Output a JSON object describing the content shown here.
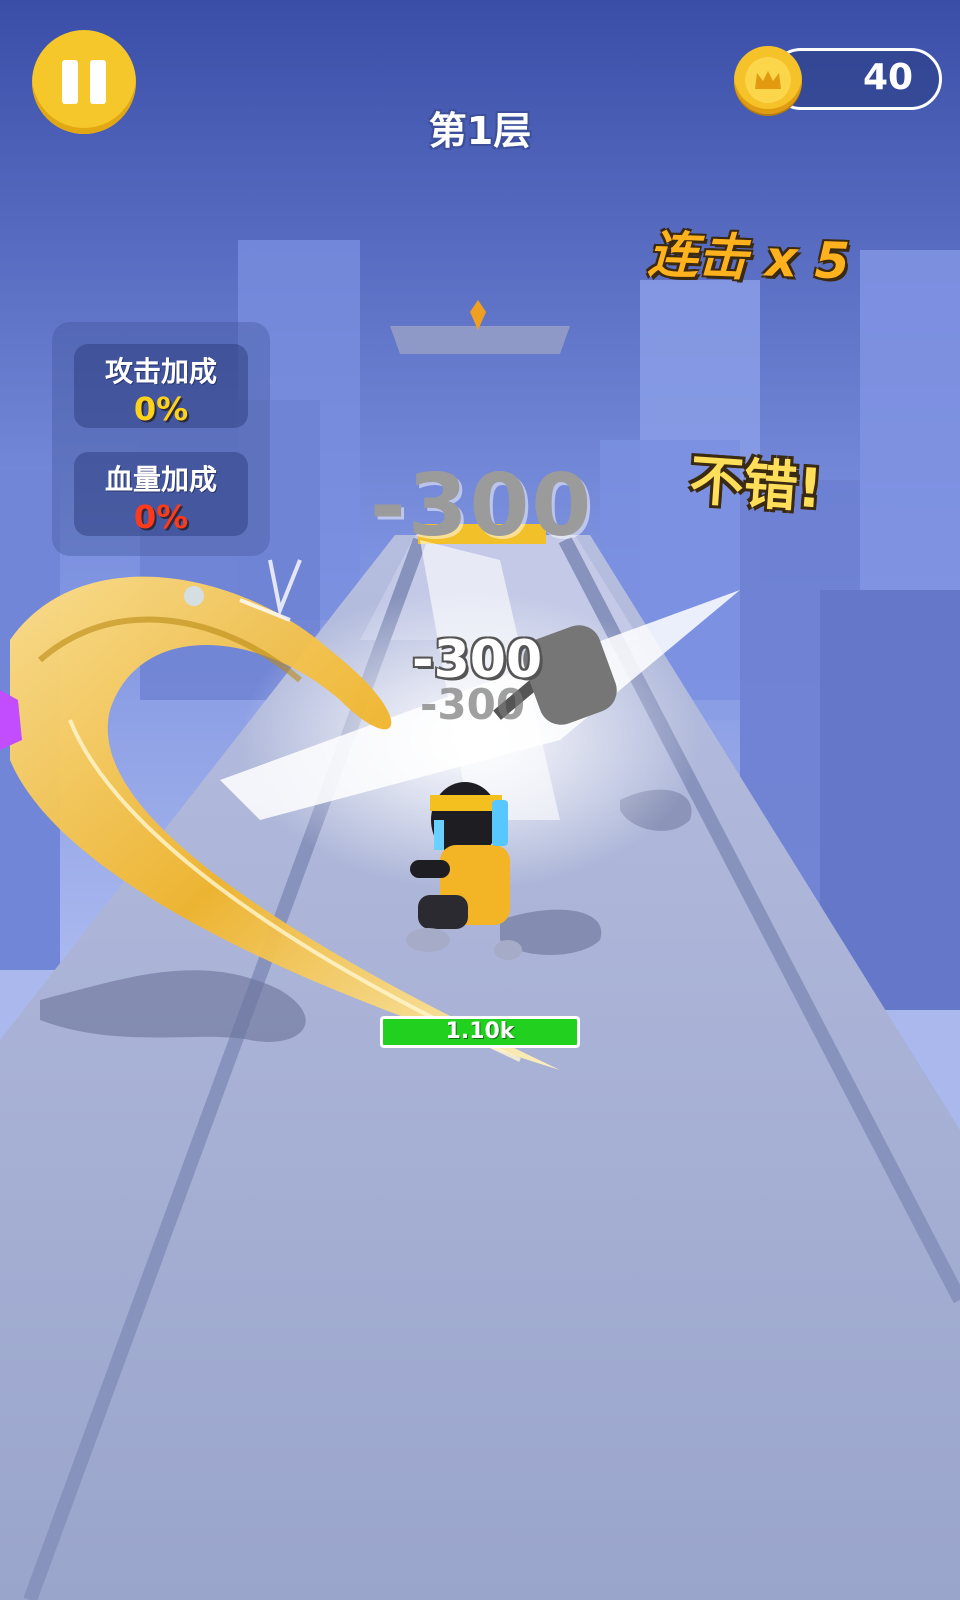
{
  "hud": {
    "level_title": "第1层",
    "coins": "40",
    "pause_icon": "pause-icon",
    "coin_icon": "crown-coin-icon"
  },
  "combo": {
    "label": "连击 x 5"
  },
  "praise": "不错!",
  "bonus_panel": {
    "attack": {
      "label": "攻击加成",
      "value": "0%",
      "color": "#ffd21a"
    },
    "health": {
      "label": "血量加成",
      "value": "0%",
      "color": "#ff3a1a"
    }
  },
  "damage_numbers": [
    "-300",
    "-300",
    "-300"
  ],
  "player": {
    "hp_label": "1.10k",
    "hp_bar_color": "#22d11f"
  },
  "colors": {
    "sky_top": "#3a4ea8",
    "sky_bottom": "#8ea2e6",
    "road": "#9aa5cc",
    "accent_yellow": "#f6c72a"
  }
}
